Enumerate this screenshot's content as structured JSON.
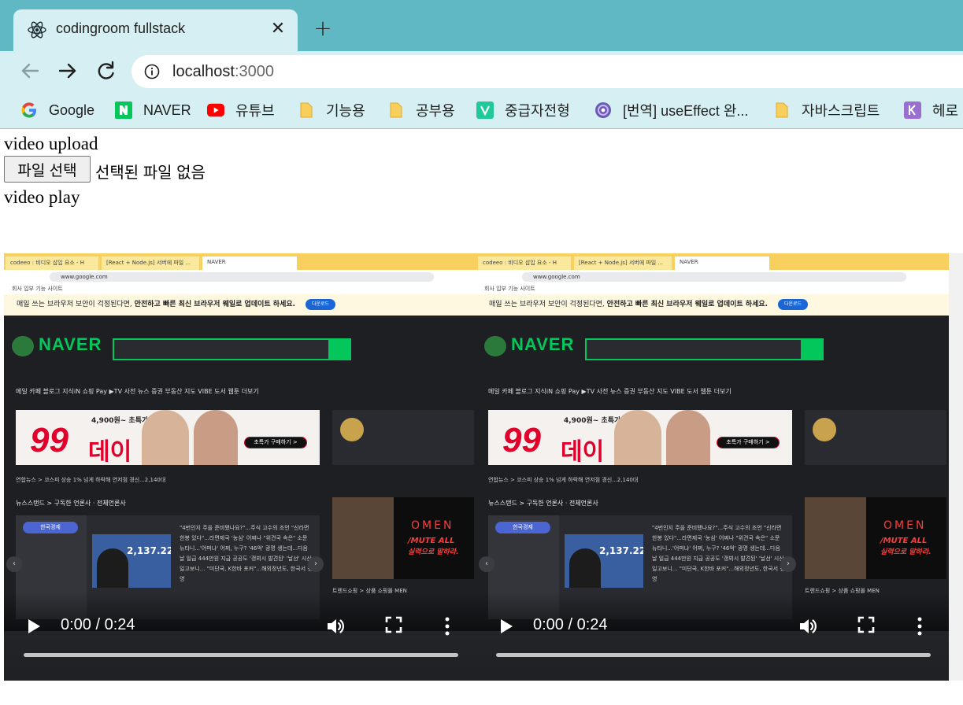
{
  "browser": {
    "tab": {
      "title": "codingroom fullstack",
      "close": "✕"
    },
    "new_tab": "+",
    "nav": {
      "back": "back",
      "forward": "forward",
      "reload": "reload"
    },
    "address": {
      "host": "localhost",
      "port": ":3000"
    },
    "bookmarks": [
      {
        "label": "Google",
        "icon": "google-icon"
      },
      {
        "label": "NAVER",
        "icon": "naver-icon"
      },
      {
        "label": "유튜브",
        "icon": "youtube-icon"
      },
      {
        "label": "기능용",
        "icon": "folder-icon"
      },
      {
        "label": "공부용",
        "icon": "folder-icon"
      },
      {
        "label": "중급자전형",
        "icon": "v-icon"
      },
      {
        "label": "[번역] useEffect 완...",
        "icon": "site-icon"
      },
      {
        "label": "자바스크립트",
        "icon": "folder-icon"
      },
      {
        "label": "헤로",
        "icon": "k-icon"
      }
    ],
    "colors": {
      "tabstrip": "#5fb8c3",
      "toolbar": "#d6eff2"
    }
  },
  "page": {
    "upload_heading": "video upload",
    "file_button": "파일 선택",
    "file_status": "선택된 파일 없음",
    "play_heading": "video play"
  },
  "videos": [
    {
      "time": "0:00 / 0:24"
    },
    {
      "time": "0:00 / 0:24"
    }
  ],
  "frame": {
    "tabs": [
      "codeeo : 비디오 삽입 요소 - H",
      "[React + Node.js] 서버에 파일 ...",
      "NAVER"
    ],
    "omnibox": "www.google.com",
    "bookmarks_line": "회사   입부   기능 사이트",
    "banner_text": "매일 쓰는 브라우저 보안이 걱정된다면,",
    "banner_bold": "안전하고 빠른 최신 브라우저 웨일로 업데이트 하세요.",
    "banner_button": "다운로드",
    "logo": "NAVER",
    "nav": "메일  카페  블로그  지식iN  쇼핑  Pay  ▶TV  사전  뉴스  증권  부동산  지도  VIBE  도서  웹툰   더보기",
    "ad_price": "4,900원~ 초특가 쇼핑 찬스!",
    "ad_99": "99",
    "ad_day": "데이",
    "ad_cta": "초특가 구매하기 >",
    "news_line": "연합뉴스 > 코스피 상승 1% 넘게 하락해 연저점 경신...2,140대",
    "newsstand": "뉴스스탠드 > 구독한 언론사 · 전체언론사",
    "ns_pill": "한국경제",
    "kospi": "2,137.22",
    "ns_text": "\"4번인지 주을 준비됐나요?\"...주식 고수의 조언 \"신라면 한봉 있다\"...라면제국 '농심' 어쩌나 \"위견국 속은\" 소문 뉴타니...'어떠냐' 어쩌, 누구? '46억' 광명 생는데...다음 날 일급 444만원 지급 공공도 '갱뵈시 발견된' '날선' 시신 일고보니... \"미단국, K한바 포커\"...해외정년도, 한국서 정영",
    "game1": "OMEN",
    "game2": "/MUTE ALL",
    "game3": "실력으로 말하라.",
    "shop": "트렌드쇼핑 >   상품  쇼핑몰  MEN"
  }
}
